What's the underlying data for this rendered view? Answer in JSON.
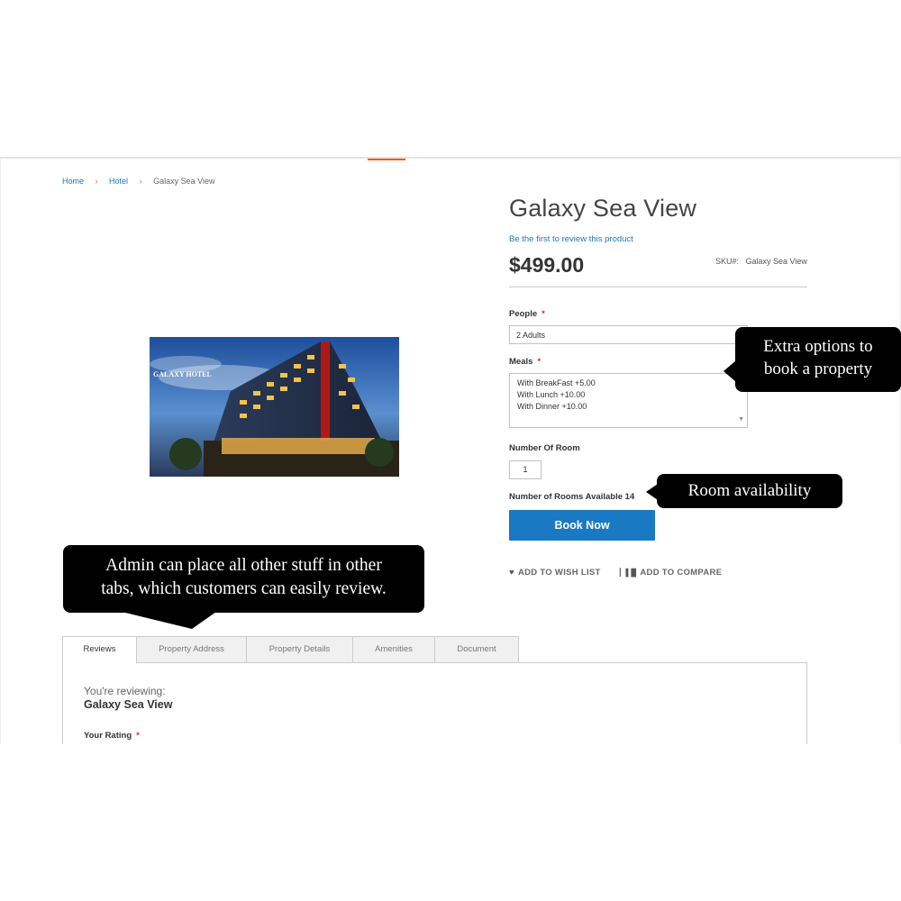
{
  "breadcrumb": {
    "home": "Home",
    "category": "Hotel",
    "current": "Galaxy Sea View",
    "sep": ">"
  },
  "product": {
    "title": "Galaxy Sea View",
    "review_link": "Be the first to review this product",
    "price": "$499.00",
    "sku_label": "SKU#:",
    "sku_value": "Galaxy Sea View",
    "image_caption": "GALAXY HOTEL"
  },
  "options": {
    "people_label": "People",
    "people_value": "2 Adults",
    "meals_label": "Meals",
    "meals_options": [
      "With BreakFast +5.00",
      "With Lunch +10.00",
      "With Dinner +10.00"
    ],
    "rooms_label": "Number Of Room",
    "rooms_value": "1",
    "required_mark": "*",
    "availability": "Number of Rooms Available 14"
  },
  "actions": {
    "book_now": "Book Now",
    "wishlist": "ADD TO WISH LIST",
    "compare": "ADD TO COMPARE"
  },
  "callouts": {
    "extra_options_line1": "Extra options to",
    "extra_options_line2": "book a property",
    "room_availability": "Room availability",
    "tabs_line1": "Admin can place all other stuff in other",
    "tabs_line2": "tabs, which customers can easily review."
  },
  "tabs": [
    "Reviews",
    "Property Address",
    "Property Details",
    "Amenities",
    "Document"
  ],
  "review_panel": {
    "reviewing_label": "You're reviewing:",
    "reviewing_name": "Galaxy Sea View",
    "rating_label": "Your Rating"
  },
  "colors": {
    "link": "#1979c3",
    "button": "#1979c3",
    "accent": "#ff5501",
    "required": "#e02b27",
    "callout_bg": "#000000"
  }
}
